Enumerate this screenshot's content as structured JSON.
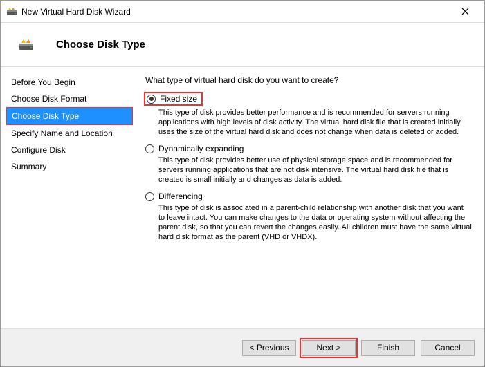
{
  "titlebar": {
    "title": "New Virtual Hard Disk Wizard"
  },
  "header": {
    "title": "Choose Disk Type"
  },
  "sidebar": {
    "items": [
      {
        "label": "Before You Begin"
      },
      {
        "label": "Choose Disk Format"
      },
      {
        "label": "Choose Disk Type"
      },
      {
        "label": "Specify Name and Location"
      },
      {
        "label": "Configure Disk"
      },
      {
        "label": "Summary"
      }
    ],
    "selected_index": 2
  },
  "content": {
    "prompt": "What type of virtual hard disk do you want to create?",
    "options": [
      {
        "label": "Fixed size",
        "selected": true,
        "description": "This type of disk provides better performance and is recommended for servers running applications with high levels of disk activity. The virtual hard disk file that is created initially uses the size of the virtual hard disk and does not change when data is deleted or added."
      },
      {
        "label": "Dynamically expanding",
        "selected": false,
        "description": "This type of disk provides better use of physical storage space and is recommended for servers running applications that are not disk intensive. The virtual hard disk file that is created is small initially and changes as data is added."
      },
      {
        "label": "Differencing",
        "selected": false,
        "description": "This type of disk is associated in a parent-child relationship with another disk that you want to leave intact. You can make changes to the data or operating system without affecting the parent disk, so that you can revert the changes easily. All children must have the same virtual hard disk format as the parent (VHD or VHDX)."
      }
    ]
  },
  "footer": {
    "previous": "< Previous",
    "next": "Next >",
    "finish": "Finish",
    "cancel": "Cancel"
  }
}
